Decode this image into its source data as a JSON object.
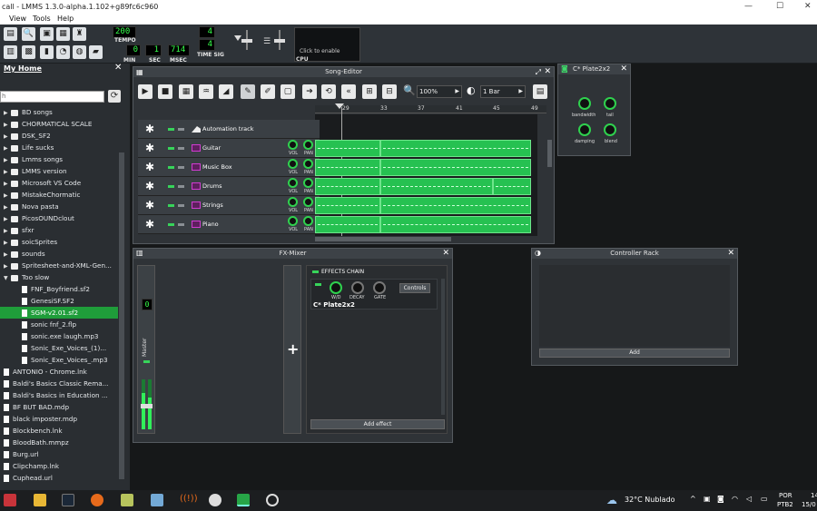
{
  "window": {
    "title": "call - LMMS 1.3.0-alpha.1.102+g89fc6c960"
  },
  "menu": [
    "View",
    "Tools",
    "Help"
  ],
  "toolbar": {
    "tempo": "200",
    "tempo_label": "TEMPO",
    "min": "0",
    "sec": "1",
    "msec": "714",
    "min_label": "MIN",
    "sec_label": "SEC",
    "msec_label": "MSEC",
    "timesig_num": "4",
    "timesig_den": "4",
    "timesig_label": "TIME SIG",
    "cpu_label": "CPU",
    "click_enable": "Click to enable"
  },
  "sidebar": {
    "title": "My Home",
    "items": [
      {
        "label": "BD songs",
        "type": "folder"
      },
      {
        "label": "CHORMATICAL SCALE",
        "type": "folder"
      },
      {
        "label": "DSK_SF2",
        "type": "folder"
      },
      {
        "label": "Life sucks",
        "type": "folder"
      },
      {
        "label": "Lmms songs",
        "type": "folder"
      },
      {
        "label": "LMMS version",
        "type": "folder"
      },
      {
        "label": "Microsoft VS Code",
        "type": "folder"
      },
      {
        "label": "MistakeChormatic",
        "type": "folder"
      },
      {
        "label": "Nova pasta",
        "type": "folder"
      },
      {
        "label": "PicosOUNDclout",
        "type": "folder"
      },
      {
        "label": "sfxr",
        "type": "folder"
      },
      {
        "label": "soicSprites",
        "type": "folder"
      },
      {
        "label": "sounds",
        "type": "folder"
      },
      {
        "label": "Spritesheet-and-XML-Gen...",
        "type": "folder"
      },
      {
        "label": "Too slow",
        "type": "folder"
      },
      {
        "label": "FNF_Boyfriend.sf2",
        "type": "file"
      },
      {
        "label": "GenesiSF.SF2",
        "type": "file"
      },
      {
        "label": "SGM-v2.01.sf2",
        "type": "file"
      },
      {
        "label": "sonic fnf_2.flp",
        "type": "file"
      },
      {
        "label": "sonic.exe laugh.mp3",
        "type": "file"
      },
      {
        "label": "Sonic_Exe_Voices_(1)...",
        "type": "file"
      },
      {
        "label": "Sonic_Exe_Voices_.mp3",
        "type": "file"
      },
      {
        "label": "ANTONIO - Chrome.lnk",
        "type": "file"
      },
      {
        "label": "Baldi's Basics Classic Rema...",
        "type": "file"
      },
      {
        "label": "Baldi's Basics in Education ...",
        "type": "file"
      },
      {
        "label": "BF BUT BAD.mdp",
        "type": "file"
      },
      {
        "label": "black imposter.mdp",
        "type": "file"
      },
      {
        "label": "Blockbench.lnk",
        "type": "file"
      },
      {
        "label": "BloodBath.mmpz",
        "type": "file"
      },
      {
        "label": "Burg.url",
        "type": "file"
      },
      {
        "label": "Clipchamp.lnk",
        "type": "file"
      },
      {
        "label": "Cuphead.url",
        "type": "file"
      }
    ]
  },
  "song_editor": {
    "title": "Song-Editor",
    "zoom": "100%",
    "quantize": "1 Bar",
    "ruler": [
      "29",
      "33",
      "37",
      "41",
      "45",
      "49"
    ],
    "tracks": [
      {
        "name": "Automation track"
      },
      {
        "name": "Guitar"
      },
      {
        "name": "Music Box"
      },
      {
        "name": "Drums"
      },
      {
        "name": "Strings"
      },
      {
        "name": "Piano"
      }
    ],
    "vol": "VOL",
    "pan": "PAN"
  },
  "plate": {
    "title": "C* Plate2x2",
    "knobs": [
      "bandwidth",
      "tail",
      "damping",
      "blend"
    ]
  },
  "fx_mixer": {
    "title": "FX-Mixer",
    "master": "Master",
    "master_value": "0",
    "effects_chain": "EFFECTS CHAIN",
    "effect_name": "C* Plate2x2",
    "knobs": [
      "W/D",
      "DECAY",
      "GATE"
    ],
    "controls": "Controls",
    "add_effect": "Add effect"
  },
  "controller_rack": {
    "title": "Controller Rack",
    "add": "Add"
  },
  "taskbar": {
    "weather": "32°C  Nublado",
    "lang1": "POR",
    "lang2": "PTB2",
    "time": "14",
    "date": "15/0"
  }
}
